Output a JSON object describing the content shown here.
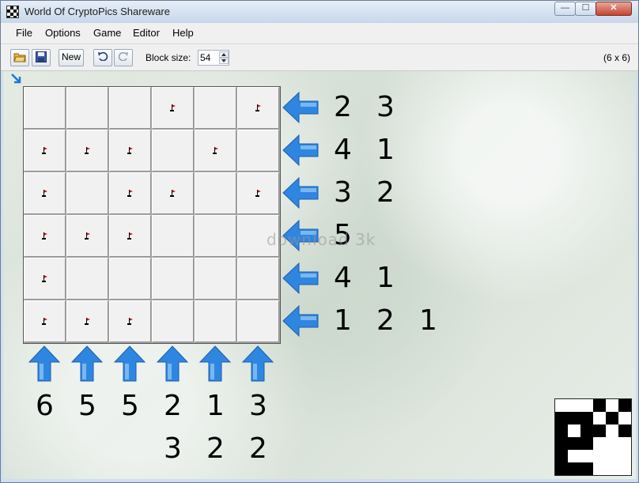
{
  "window": {
    "title": "World Of CryptoPics Shareware",
    "minimize": "—",
    "maximize": "☐",
    "close": "✕"
  },
  "menu": [
    "File",
    "Options",
    "Game",
    "Editor",
    "Help"
  ],
  "toolbar": {
    "new_label": "New",
    "block_size_label": "Block size:",
    "block_size_value": "54",
    "grid_size": "(6 x 6)"
  },
  "watermark": "download 3k",
  "colors": {
    "arrow": "#2f86e0",
    "cell": "#f1f1f1",
    "flag": "#c41212"
  },
  "board": {
    "rows": 6,
    "cols": 6,
    "flags": [
      [
        0,
        0,
        0,
        1,
        0,
        1
      ],
      [
        1,
        1,
        1,
        0,
        1,
        0
      ],
      [
        1,
        0,
        1,
        1,
        0,
        1
      ],
      [
        1,
        1,
        1,
        0,
        0,
        0
      ],
      [
        1,
        0,
        0,
        0,
        0,
        0
      ],
      [
        1,
        1,
        1,
        0,
        0,
        0
      ]
    ]
  },
  "row_clues": [
    [
      "2",
      "3"
    ],
    [
      "4",
      "1"
    ],
    [
      "3",
      "2"
    ],
    [
      "5"
    ],
    [
      "4",
      "1"
    ],
    [
      "1",
      "2",
      "1"
    ]
  ],
  "col_clues": [
    [
      "6"
    ],
    [
      "5"
    ],
    [
      "5"
    ],
    [
      "2",
      "3"
    ],
    [
      "1",
      "2"
    ],
    [
      "3",
      "2"
    ]
  ],
  "preview": {
    "pattern": [
      [
        0,
        0,
        0,
        1,
        0,
        1
      ],
      [
        1,
        1,
        1,
        0,
        1,
        0
      ],
      [
        1,
        0,
        1,
        1,
        0,
        1
      ],
      [
        1,
        1,
        1,
        0,
        0,
        0
      ],
      [
        1,
        0,
        0,
        0,
        0,
        0
      ],
      [
        1,
        1,
        1,
        0,
        0,
        0
      ]
    ]
  }
}
